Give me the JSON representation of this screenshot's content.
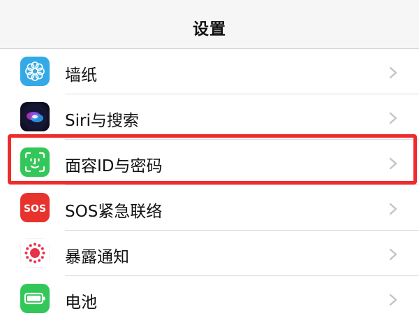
{
  "header": {
    "title": "设置"
  },
  "settings": {
    "items": [
      {
        "label": "墙纸",
        "icon": "wallpaper-icon",
        "icon_color": "#33a9e6"
      },
      {
        "label": "Siri与搜索",
        "icon": "siri-icon",
        "icon_color": "#1b1b3a"
      },
      {
        "label": "面容ID与密码",
        "icon": "face-id-icon",
        "icon_color": "#33c759"
      },
      {
        "label": "SOS紧急联络",
        "icon": "sos-icon",
        "icon_text": "SOS",
        "icon_color": "#e8322e"
      },
      {
        "label": "暴露通知",
        "icon": "exposure-notification-icon",
        "icon_color": "#e8324a"
      },
      {
        "label": "电池",
        "icon": "battery-icon",
        "icon_color": "#33c759"
      }
    ]
  },
  "annotation": {
    "highlight_color": "#ef2b2b",
    "highlighted_item": "面容ID与密码"
  }
}
